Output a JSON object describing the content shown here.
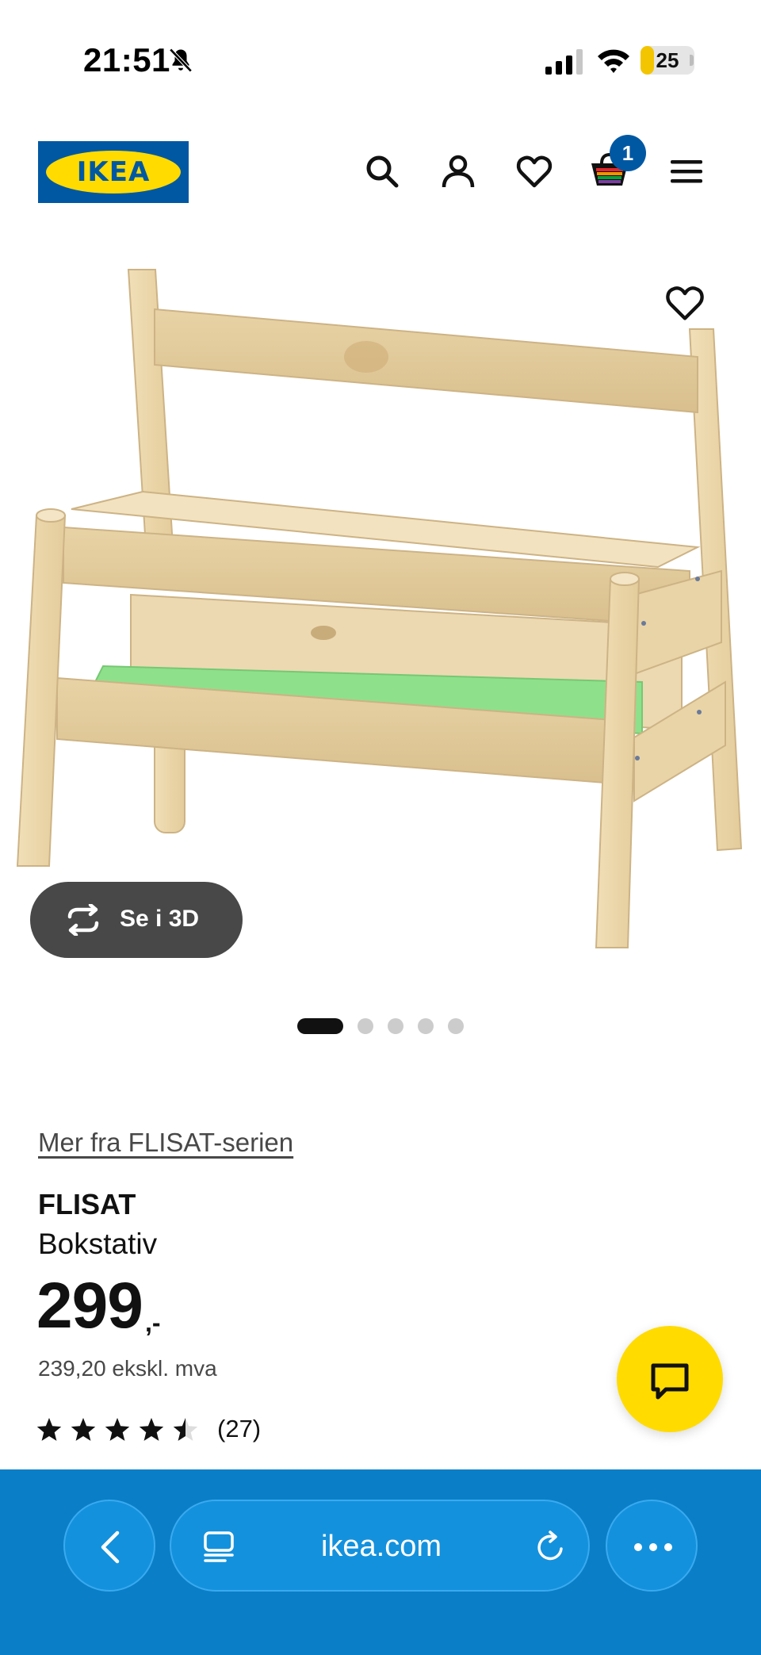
{
  "status_bar": {
    "time": "21:51",
    "battery_level": "25",
    "icons": [
      "bell-slash-icon",
      "cellular-signal-icon",
      "wifi-icon",
      "battery-icon"
    ]
  },
  "header": {
    "logo_text": "IKEA",
    "cart_count": "1",
    "icons": [
      "search-icon",
      "account-icon",
      "heart-icon",
      "cart-icon",
      "menu-icon"
    ]
  },
  "gallery": {
    "view_3d_label": "Se i 3D",
    "slide_count": 5,
    "active_slide": 1
  },
  "product": {
    "series_link": "Mer fra FLISAT-serien",
    "name": "FLISAT",
    "type": "Bokstativ",
    "price": "299",
    "price_suffix": ",-",
    "price_ex_vat": "239,20 ekskl. mva",
    "rating": 4.5,
    "rating_max": 5,
    "review_count": "(27)"
  },
  "browser": {
    "url": "ikea.com"
  },
  "colors": {
    "ikea_blue": "#0058a3",
    "ikea_yellow": "#ffdb00",
    "browser_bar": "#0a7fc7"
  }
}
